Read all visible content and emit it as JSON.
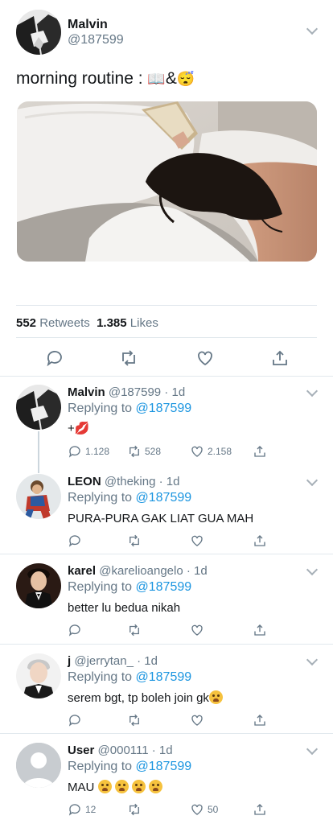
{
  "main_tweet": {
    "name": "Malvin",
    "handle": "@187599",
    "text": "morning routine : 📖&😴",
    "text_plain": "morning routine : ",
    "emoji_book": "📖",
    "emoji_amp": "&",
    "emoji_sleep": "😴",
    "retweets_count": "552",
    "retweets_label": "Retweets",
    "likes_count": "1.385",
    "likes_label": "Likes"
  },
  "replies": [
    {
      "name": "Malvin",
      "handle": "@187599 · 1d",
      "replying_prefix": "Replying to",
      "replying_to": "@187599",
      "text": "+💋",
      "comments": "1.128",
      "retweets": "528",
      "likes": "2.158"
    },
    {
      "name": "LEON",
      "handle": "@theking · 1d",
      "replying_prefix": "Replying to",
      "replying_to": "@187599",
      "text": "PURA-PURA GAK LIAT GUA MAH",
      "comments": "",
      "retweets": "",
      "likes": ""
    },
    {
      "name": "karel",
      "handle": "@karelioangelo · 1d",
      "replying_prefix": "Replying to",
      "replying_to": "@187599",
      "text": "better lu bedua nikah",
      "comments": "",
      "retweets": "",
      "likes": ""
    },
    {
      "name": "j",
      "handle": "@jerrytan_ · 1d",
      "replying_prefix": "Replying to",
      "replying_to": "@187599",
      "text": "serem bgt, tp boleh join gk",
      "comments": "",
      "retweets": "",
      "likes": ""
    },
    {
      "name": "User",
      "handle": "@000111 · 1d",
      "replying_prefix": "Replying to",
      "replying_to": "@187599",
      "text": "MAU",
      "comments": "12",
      "retweets": "",
      "likes": "50"
    }
  ],
  "colors": {
    "link": "#1b95e0",
    "muted": "#657786",
    "icon": "#657786",
    "divider": "#e1e8ed"
  },
  "icons": [
    "comment-icon",
    "retweet-icon",
    "heart-icon",
    "share-icon",
    "chevron-down-icon"
  ]
}
